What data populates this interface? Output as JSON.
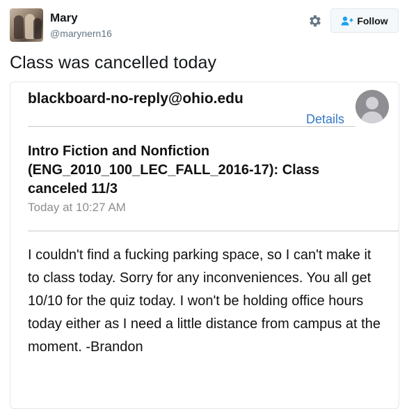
{
  "tweet": {
    "author": {
      "display_name": "Mary",
      "screen_name": "@marynern16",
      "avatar": "profile-photo"
    },
    "actions": {
      "settings_icon": "gear-icon",
      "follow_icon": "add-user-icon",
      "follow_label": "Follow"
    },
    "text": "Class was cancelled today"
  },
  "email": {
    "sender": "blackboard-no-reply@ohio.edu",
    "details_label": "Details",
    "sender_avatar": "person-silhouette-icon",
    "subject": "Intro Fiction and Nonfiction (ENG_2010_100_LEC_FALL_2016-17): Class canceled 11/3",
    "time": "Today at 10:27 AM",
    "body": "I couldn't find a fucking parking space, so I can't make it to class today. Sorry for any inconveniences. You all get 10/10 for the quiz today. I won't be holding office hours today either as I need a little distance from campus at the moment. -Brandon"
  },
  "colors": {
    "link": "#3478c6",
    "muted": "#657786",
    "follow_icon": "#1da1f2",
    "avatar_gray": "#8e8e93"
  }
}
